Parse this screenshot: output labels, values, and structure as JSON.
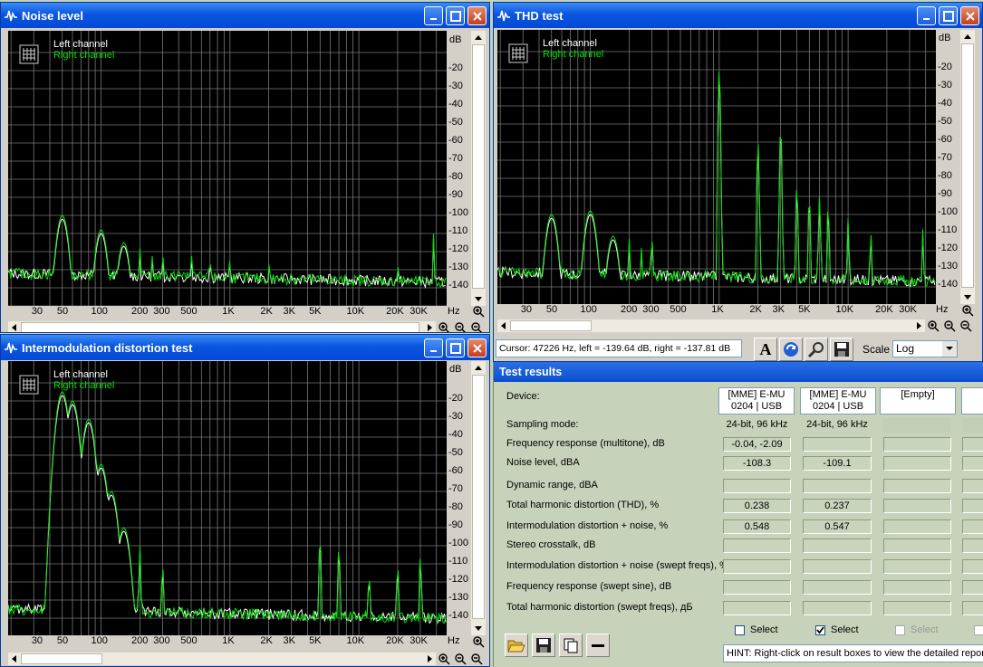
{
  "noise_window": {
    "title": "Noise level",
    "legend_left": "Left channel",
    "legend_right": "Right channel",
    "y_unit": "dB",
    "x_unit": "Hz"
  },
  "thd_window": {
    "title": "THD test",
    "legend_left": "Left channel",
    "legend_right": "Right channel",
    "y_unit": "dB",
    "x_unit": "Hz",
    "cursor_text": "Cursor:  47226 Hz,  left = -139.64 dB,  right = -137.81 dB",
    "scale_label": "Scale",
    "scale_value": "Log"
  },
  "imd_window": {
    "title": "Intermodulation distortion test",
    "legend_left": "Left channel",
    "legend_right": "Right channel",
    "y_unit": "dB",
    "x_unit": "Hz"
  },
  "y_ticks": [
    "-20",
    "-30",
    "-40",
    "-50",
    "-60",
    "-70",
    "-80",
    "-90",
    "-100",
    "-110",
    "-120",
    "-130",
    "-140"
  ],
  "x_ticks": [
    "30",
    "50",
    "100",
    "200",
    "300",
    "500",
    "1K",
    "2K",
    "3K",
    "5K",
    "10K",
    "20K",
    "30K"
  ],
  "results": {
    "title": "Test results",
    "device_label": "Device:",
    "devices": [
      "[MME] E-MU\n0204 | USB",
      "[MME] E-MU\n0204 | USB",
      "[Empty]"
    ],
    "rows": [
      {
        "label": "Sampling mode:",
        "v1": "24-bit, 96 kHz",
        "v2": "24-bit, 96 kHz",
        "plain": true
      },
      {
        "label": "Frequency response (multitone), dB",
        "v1": "-0.04, -2.09",
        "v2": ""
      },
      {
        "label": "Noise level, dBA",
        "v1": "-108.3",
        "v2": "-109.1"
      },
      {
        "label": "Dynamic range, dBA",
        "v1": "",
        "v2": ""
      },
      {
        "label": "Total harmonic distortion (THD), %",
        "v1": "0.238",
        "v2": "0.237"
      },
      {
        "label": "Intermodulation distortion + noise, %",
        "v1": "0.548",
        "v2": "0.547"
      },
      {
        "label": "Stereo crosstalk, dB",
        "v1": "",
        "v2": ""
      },
      {
        "label": "Intermodulation distortion + noise (swept freqs), %",
        "v1": "",
        "v2": ""
      },
      {
        "label": "Frequency response (swept sine), dB",
        "v1": "",
        "v2": ""
      },
      {
        "label": "Total harmonic distortion (swept freqs), дБ",
        "v1": "",
        "v2": ""
      }
    ],
    "select_labels": [
      "Select",
      "Select",
      "Select"
    ],
    "select_checked": [
      false,
      true,
      false
    ],
    "hint": "HINT: Right-click on result boxes to view the detailed report"
  },
  "colors": {
    "title_bar": "#0a56e0",
    "plot_bg": "#000000",
    "left_channel": "#ffffff",
    "right_channel": "#00e000",
    "results_bg": "#c6d2b9"
  }
}
